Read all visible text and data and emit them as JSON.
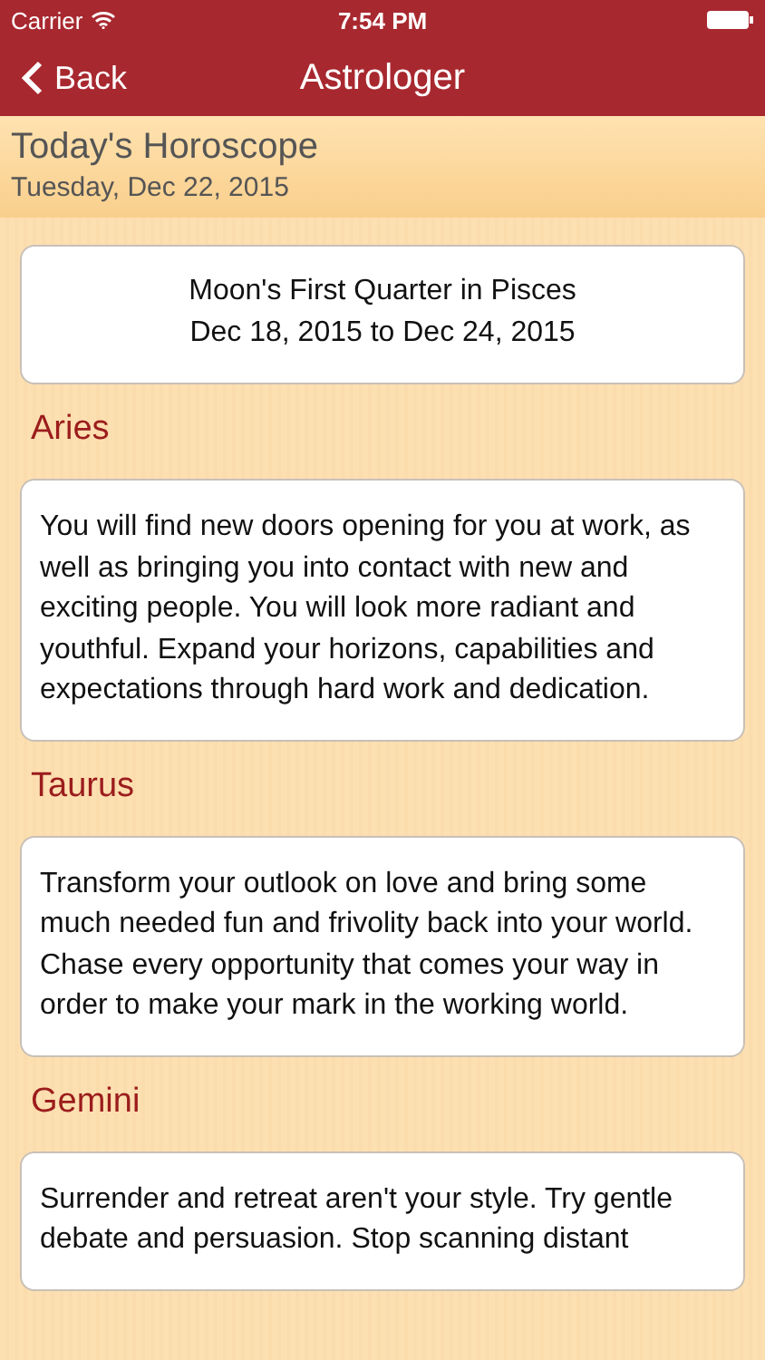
{
  "status_bar": {
    "carrier": "Carrier",
    "time": "7:54 PM"
  },
  "nav": {
    "back": "Back",
    "title": "Astrologer"
  },
  "header": {
    "title": "Today's Horoscope",
    "date": "Tuesday, Dec 22, 2015"
  },
  "moon": {
    "phase": "Moon's First Quarter in Pisces",
    "range": "Dec 18, 2015 to Dec 24, 2015"
  },
  "signs": [
    {
      "name": "Aries",
      "text": "You will find new doors opening for you at work, as well as bringing you into contact with new and exciting people. You will look more radiant and youthful. Expand your horizons, capabilities and expectations through hard work and dedication."
    },
    {
      "name": "Taurus",
      "text": "Transform your outlook on love and bring some much needed fun and frivolity back into your world. Chase every opportunity that comes your way in order to make your mark in the working world."
    },
    {
      "name": "Gemini",
      "text": "Surrender and retreat aren't your style. Try gentle debate and persuasion. Stop scanning distant"
    }
  ]
}
